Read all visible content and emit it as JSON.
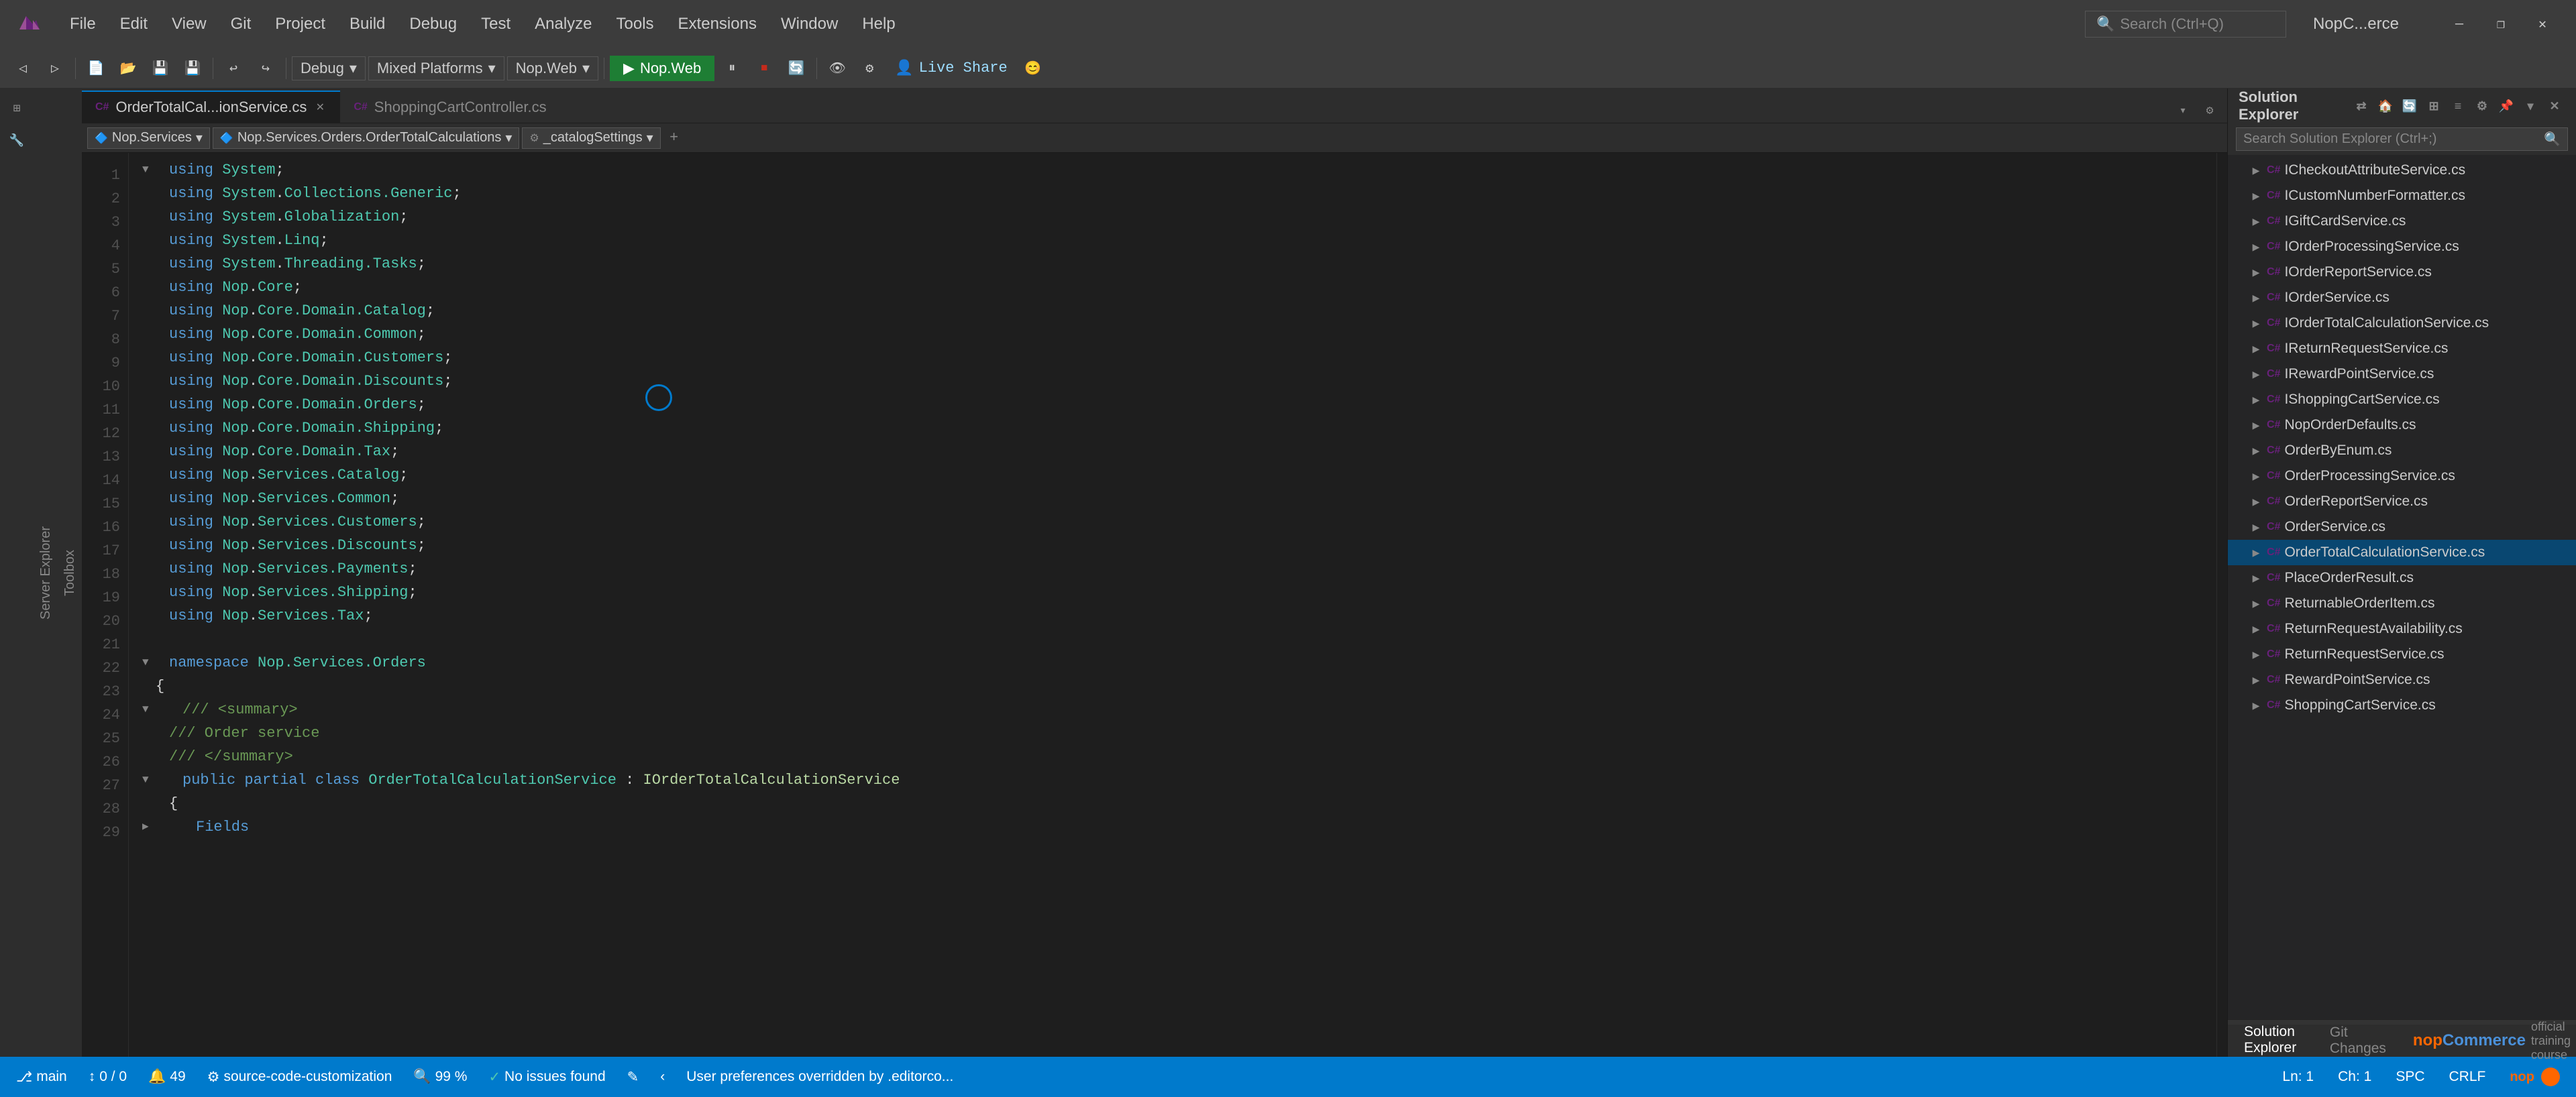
{
  "titleBar": {
    "menuItems": [
      "File",
      "Edit",
      "View",
      "Git",
      "Project",
      "Build",
      "Debug",
      "Test",
      "Analyze",
      "Tools",
      "Extensions",
      "Window",
      "Help"
    ],
    "searchPlaceholder": "Search (Ctrl+Q)",
    "windowTitle": "NopC...erce",
    "controls": [
      "—",
      "❐",
      "✕"
    ]
  },
  "toolbar": {
    "debugMode": "Debug",
    "platform": "Mixed Platforms",
    "target": "Nop.Web",
    "liveShare": "Live Share"
  },
  "tabs": [
    {
      "label": "OrderTotalCal...ionService.cs",
      "active": true,
      "icon": "C#"
    },
    {
      "label": "ShoppingCartController.cs",
      "active": false,
      "icon": "C#"
    }
  ],
  "navBar": {
    "namespace": "Nop.Services",
    "class": "Nop.Services.Orders.OrderTotalCalculations",
    "member": "_catalogSettings"
  },
  "codeLines": [
    {
      "num": "",
      "indent": "i2",
      "content": "using System;"
    },
    {
      "num": "",
      "indent": "i2",
      "content": "using System.Collections.Generic;"
    },
    {
      "num": "",
      "indent": "i2",
      "content": "using System.Globalization;"
    },
    {
      "num": "",
      "indent": "i2",
      "content": "using System.Linq;"
    },
    {
      "num": "",
      "indent": "i2",
      "content": "using System.Threading.Tasks;"
    },
    {
      "num": "",
      "indent": "i2",
      "content": "using Nop.Core;"
    },
    {
      "num": "",
      "indent": "i2",
      "content": "using Nop.Core.Domain.Catalog;"
    },
    {
      "num": "",
      "indent": "i2",
      "content": "using Nop.Core.Domain.Common;"
    },
    {
      "num": "",
      "indent": "i2",
      "content": "using Nop.Core.Domain.Customers;"
    },
    {
      "num": "",
      "indent": "i2",
      "content": "using Nop.Core.Domain.Discounts;"
    },
    {
      "num": "",
      "indent": "i2",
      "content": "using Nop.Core.Domain.Orders;"
    },
    {
      "num": "",
      "indent": "i2",
      "content": "using Nop.Core.Domain.Shipping;"
    },
    {
      "num": "",
      "indent": "i2",
      "content": "using Nop.Core.Domain.Tax;"
    },
    {
      "num": "",
      "indent": "i2",
      "content": "using Nop.Services.Catalog;"
    },
    {
      "num": "",
      "indent": "i2",
      "content": "using Nop.Services.Common;"
    },
    {
      "num": "",
      "indent": "i2",
      "content": "using Nop.Services.Customers;"
    },
    {
      "num": "",
      "indent": "i2",
      "content": "using Nop.Services.Discounts;"
    },
    {
      "num": "",
      "indent": "i2",
      "content": "using Nop.Services.Payments;"
    },
    {
      "num": "",
      "indent": "i2",
      "content": "using Nop.Services.Shipping;"
    },
    {
      "num": "",
      "indent": "i2",
      "content": "using Nop.Services.Tax;"
    },
    {
      "num": "",
      "indent": "i1",
      "content": ""
    },
    {
      "num": "",
      "indent": "i1",
      "content": "namespace Nop.Services.Orders",
      "hasFold": true
    },
    {
      "num": "",
      "indent": "i1",
      "content": "{"
    },
    {
      "num": "",
      "indent": "i2",
      "content": "/// <summary>",
      "hasFold": true
    },
    {
      "num": "",
      "indent": "i2",
      "content": "/// Order service"
    },
    {
      "num": "",
      "indent": "i2",
      "content": "/// </summary>"
    },
    {
      "num": "",
      "indent": "i2",
      "content": "public partial class OrderTotalCalculationService : IOrderTotalCalculationService",
      "hasFold": true
    },
    {
      "num": "",
      "indent": "i2",
      "content": "{"
    },
    {
      "num": "",
      "indent": "i3",
      "content": "Fields"
    }
  ],
  "lineNumbers": [
    1,
    2,
    3,
    4,
    5,
    6,
    7,
    8,
    9,
    10,
    11,
    12,
    13,
    14,
    15,
    16,
    17,
    18,
    19,
    20,
    21,
    22,
    23,
    24,
    25,
    26,
    27,
    28,
    29
  ],
  "solutionExplorer": {
    "title": "Solution Explorer",
    "searchPlaceholder": "Search Solution Explorer (Ctrl+;)",
    "files": [
      {
        "name": "ICheckoutAttributeService.cs",
        "type": "cs",
        "indent": 1
      },
      {
        "name": "ICustomNumberFormatter.cs",
        "type": "cs",
        "indent": 1
      },
      {
        "name": "IGiftCardService.cs",
        "type": "cs",
        "indent": 1
      },
      {
        "name": "IOrderProcessingService.cs",
        "type": "cs",
        "indent": 1
      },
      {
        "name": "IOrderReportService.cs",
        "type": "cs",
        "indent": 1
      },
      {
        "name": "IOrderService.cs",
        "type": "cs",
        "indent": 1
      },
      {
        "name": "IOrderTotalCalculationService.cs",
        "type": "cs",
        "indent": 1
      },
      {
        "name": "IReturnRequestService.cs",
        "type": "cs",
        "indent": 1
      },
      {
        "name": "IRewardPointService.cs",
        "type": "cs",
        "indent": 1
      },
      {
        "name": "IShoppingCartService.cs",
        "type": "cs",
        "indent": 1
      },
      {
        "name": "NopOrderDefaults.cs",
        "type": "cs",
        "indent": 1
      },
      {
        "name": "OrderByEnum.cs",
        "type": "cs",
        "indent": 1
      },
      {
        "name": "OrderProcessingService.cs",
        "type": "cs",
        "indent": 1
      },
      {
        "name": "OrderReportService.cs",
        "type": "cs",
        "indent": 1
      },
      {
        "name": "OrderService.cs",
        "type": "cs",
        "indent": 1
      },
      {
        "name": "OrderTotalCalculationService.cs",
        "type": "cs",
        "indent": 1,
        "selected": true
      },
      {
        "name": "PlaceOrderResult.cs",
        "type": "cs",
        "indent": 1
      },
      {
        "name": "ReturnableOrderItem.cs",
        "type": "cs",
        "indent": 1
      },
      {
        "name": "ReturnRequestAvailability.cs",
        "type": "cs",
        "indent": 1
      },
      {
        "name": "ReturnRequestService.cs",
        "type": "cs",
        "indent": 1
      },
      {
        "name": "RewardPointService.cs",
        "type": "cs",
        "indent": 1
      },
      {
        "name": "ShoppingCartService.cs",
        "type": "cs",
        "indent": 1
      }
    ]
  },
  "statusBar": {
    "zoom": "99 %",
    "errors": "No issues found",
    "line": "Ln: 1",
    "col": "Ch: 1",
    "encoding": "SPC",
    "lineEnding": "CRLF",
    "gitBranch": "main",
    "notifications": "49",
    "bottomTabs": [
      "Solution Explorer",
      "Git Changes"
    ],
    "sourceCode": "source-code-customization",
    "userPrefs": "User preferences overridden by .editorco...",
    "gitStatus": "0 / 0"
  },
  "sidebarLabels": [
    "Server Explorer",
    "Toolbox"
  ],
  "colors": {
    "accent": "#007acc",
    "background": "#1e1e1e",
    "sidebar": "#252526",
    "tabBar": "#2d2d2d",
    "keyword": "#569cd6",
    "type": "#4ec9b0",
    "comment": "#6a9955",
    "string": "#ce9178",
    "interface": "#b8d7a3"
  }
}
